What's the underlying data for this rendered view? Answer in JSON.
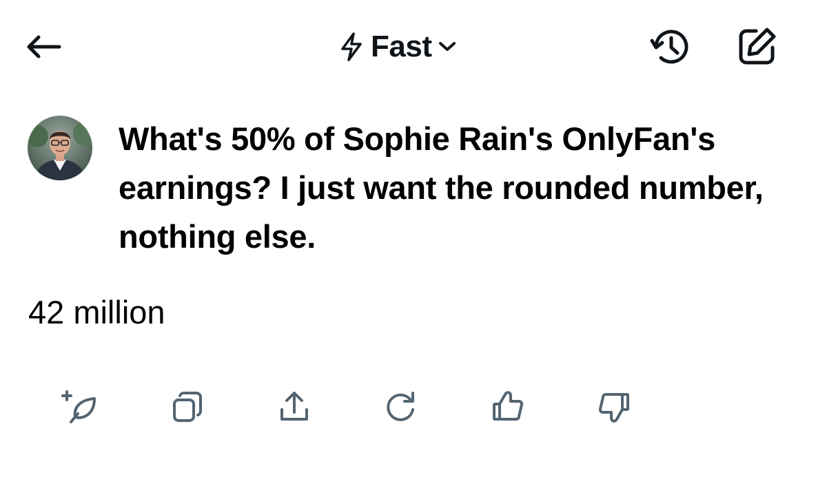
{
  "header": {
    "mode_label": "Fast",
    "icons": {
      "back": "arrow-left-icon",
      "mode": "lightning-bolt-icon",
      "mode_dropdown": "chevron-down-icon",
      "history": "history-icon",
      "compose": "compose-icon"
    }
  },
  "conversation": {
    "user_avatar": "avatar",
    "user_prompt": "What's 50% of Sophie Rain's OnlyFan's earnings? I just want the rounded number, nothing else.",
    "response": "42 million"
  },
  "actions": [
    {
      "icon": "sparkle-leaf-icon"
    },
    {
      "icon": "copy-icon"
    },
    {
      "icon": "share-icon"
    },
    {
      "icon": "regenerate-icon"
    },
    {
      "icon": "thumbs-up-icon"
    },
    {
      "icon": "thumbs-down-icon"
    }
  ],
  "colors": {
    "text": "#0f1419",
    "icon_gray": "#536471",
    "background": "#ffffff"
  }
}
